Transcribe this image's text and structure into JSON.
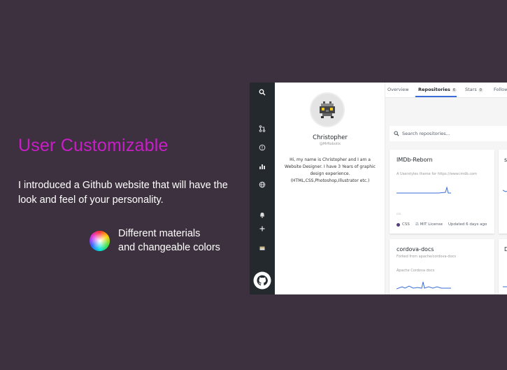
{
  "promo": {
    "title": "User Customizable",
    "description": "I introduced a Github website that will have the look and feel of your personality.",
    "feature_line1": "Different materials",
    "feature_line2": "and changeable colors"
  },
  "sidebar": {
    "icons": [
      "search-icon",
      "pull-request-icon",
      "issue-icon",
      "chart-icon",
      "globe-icon",
      "bell-icon",
      "plus-icon",
      "inbox-icon",
      "github-logo-icon"
    ]
  },
  "profile": {
    "name": "Christopher",
    "username": "@MrRobotix",
    "bio": "Hi, my name is Christopher and I am a Website Designer. I have 3 Years of graphic design experience. (HTML,CSS,Photoshop,Illustrator etc.)"
  },
  "tabs": [
    {
      "label": "Overview",
      "count": ""
    },
    {
      "label": "Repositories",
      "count": "6"
    },
    {
      "label": "Stars",
      "count": "0"
    },
    {
      "label": "Follow",
      "count": ""
    }
  ],
  "search": {
    "placeholder": "Search repositories..."
  },
  "repos": [
    {
      "name": "IMDb-Reborn",
      "description": "A Userstyles theme for https://www.imdb.com",
      "lang_small": "css",
      "language": "CSS",
      "license": "MIT License",
      "updated": "Updated 6 days ago"
    },
    {
      "name": "cordova-docs",
      "forked_from": "Forked from apache/cordova-docs",
      "description": "Apache Cordova docs"
    },
    {
      "name_partial": "s"
    },
    {
      "name_partial": "D"
    }
  ],
  "colors": {
    "accent": "#c81ec8",
    "background": "#3e313f",
    "sidebar": "#24292e",
    "link": "#3a6dd8",
    "css_lang": "#563d7c"
  }
}
